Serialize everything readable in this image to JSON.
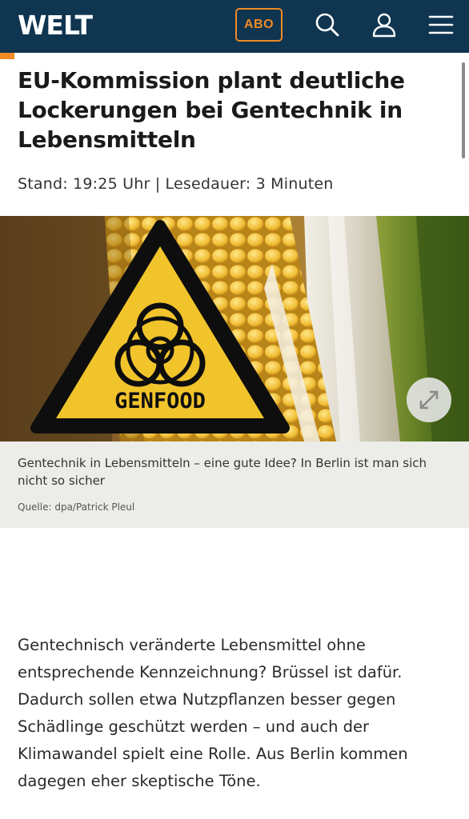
{
  "header": {
    "logo": "WELT",
    "abo_label": "ABO",
    "icons": [
      "search-icon",
      "user-icon",
      "menu-icon"
    ],
    "colors": {
      "background": "#0f3551",
      "accent": "#f08a24"
    }
  },
  "article": {
    "headline": "EU-Kommission plant deutliche Lockerungen bei Gentechnik in Lebensmitteln",
    "meta": "Stand: 19:25 Uhr | Lesedauer: 3 Minuten",
    "image": {
      "sign_text": "GENFOOD",
      "expand_icon": "expand-icon"
    },
    "caption": "Gentechnik in Lebensmitteln – eine gute Idee? In Berlin ist man sich nicht so sicher",
    "source": "Quelle: dpa/Patrick Pleul",
    "lead": "Gentechnisch veränderte Lebensmittel ohne entsprechende Kennzeichnung? Brüssel ist dafür. Dadurch sollen etwa Nutzpflanzen besser gegen Schädlinge geschützt werden – und auch der Klimawandel spielt eine Rolle. Aus Berlin kommen dagegen eher skeptische Töne."
  }
}
